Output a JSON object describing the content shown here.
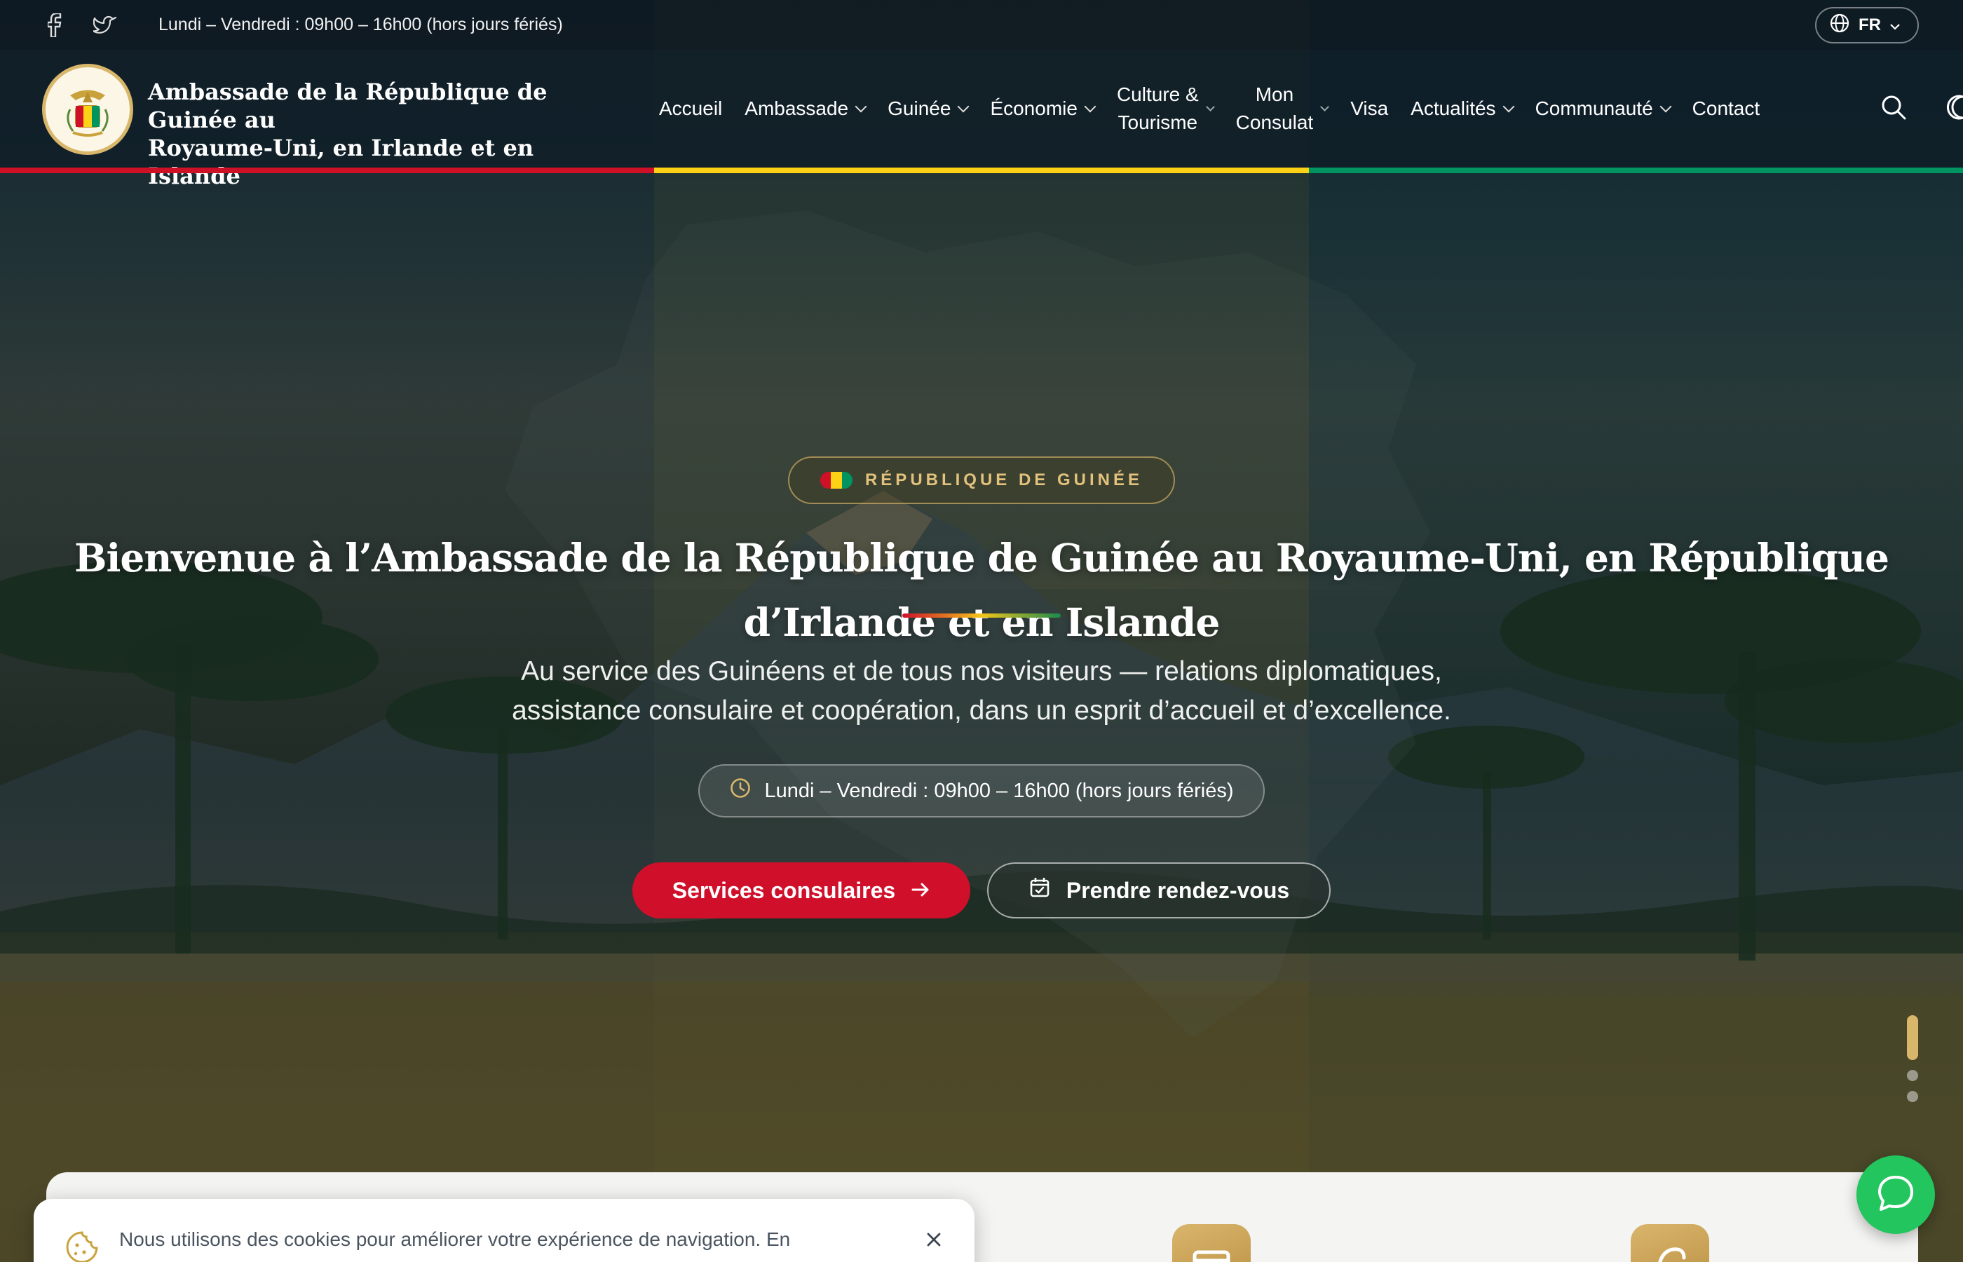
{
  "topbar": {
    "social": [
      {
        "icon": "facebook-icon"
      },
      {
        "icon": "twitter-icon"
      }
    ],
    "hours": "Lundi – Vendredi : 09h00 – 16h00 (hors jours fériés)",
    "language": "FR"
  },
  "header": {
    "site_title_line1": "Ambassade de la République de Guinée au",
    "site_title_line2": "Royaume-Uni, en Irlande et en Islande",
    "nav": [
      {
        "label": "Accueil",
        "dropdown": false
      },
      {
        "label": "Ambassade",
        "dropdown": true
      },
      {
        "label": "Guinée",
        "dropdown": true
      },
      {
        "label": "Économie",
        "dropdown": true
      },
      {
        "label_line1": "Culture &",
        "label_line2": "Tourisme",
        "dropdown": true
      },
      {
        "label_line1": "Mon",
        "label_line2": "Consulat",
        "dropdown": true
      },
      {
        "label": "Visa",
        "dropdown": false
      },
      {
        "label": "Actualités",
        "dropdown": true
      },
      {
        "label": "Communauté",
        "dropdown": true
      },
      {
        "label": "Contact",
        "dropdown": false
      }
    ],
    "icons": [
      "search-icon",
      "dark-mode-icon"
    ]
  },
  "colors": {
    "flag_red": "#ce1126",
    "flag_yellow": "#fcd116",
    "flag_green": "#009460",
    "accent_gold": "#d8b66a",
    "primary_button": "#d0102a",
    "chat_green": "#22c55e"
  },
  "hero": {
    "kicker": "RÉPUBLIQUE DE GUINÉE",
    "title": "Bienvenue à l’Ambassade de la République de Guinée au Royaume-Uni, en République d’Irlande et en Islande",
    "subtitle_line1": "Au service des Guinéens et de tous nos visiteurs — relations diplomatiques,",
    "subtitle_line2": "assistance consulaire et coopération, dans un esprit d’accueil et d’excellence.",
    "hours": "Lundi – Vendredi : 09h00 – 16h00 (hors jours fériés)",
    "primary_cta": "Services consulaires",
    "secondary_cta": "Prendre rendez-vous",
    "slides": {
      "count": 3,
      "active": 1
    }
  },
  "cookie": {
    "text": "Nous utilisons des cookies pour améliorer votre expérience de navigation. En"
  }
}
